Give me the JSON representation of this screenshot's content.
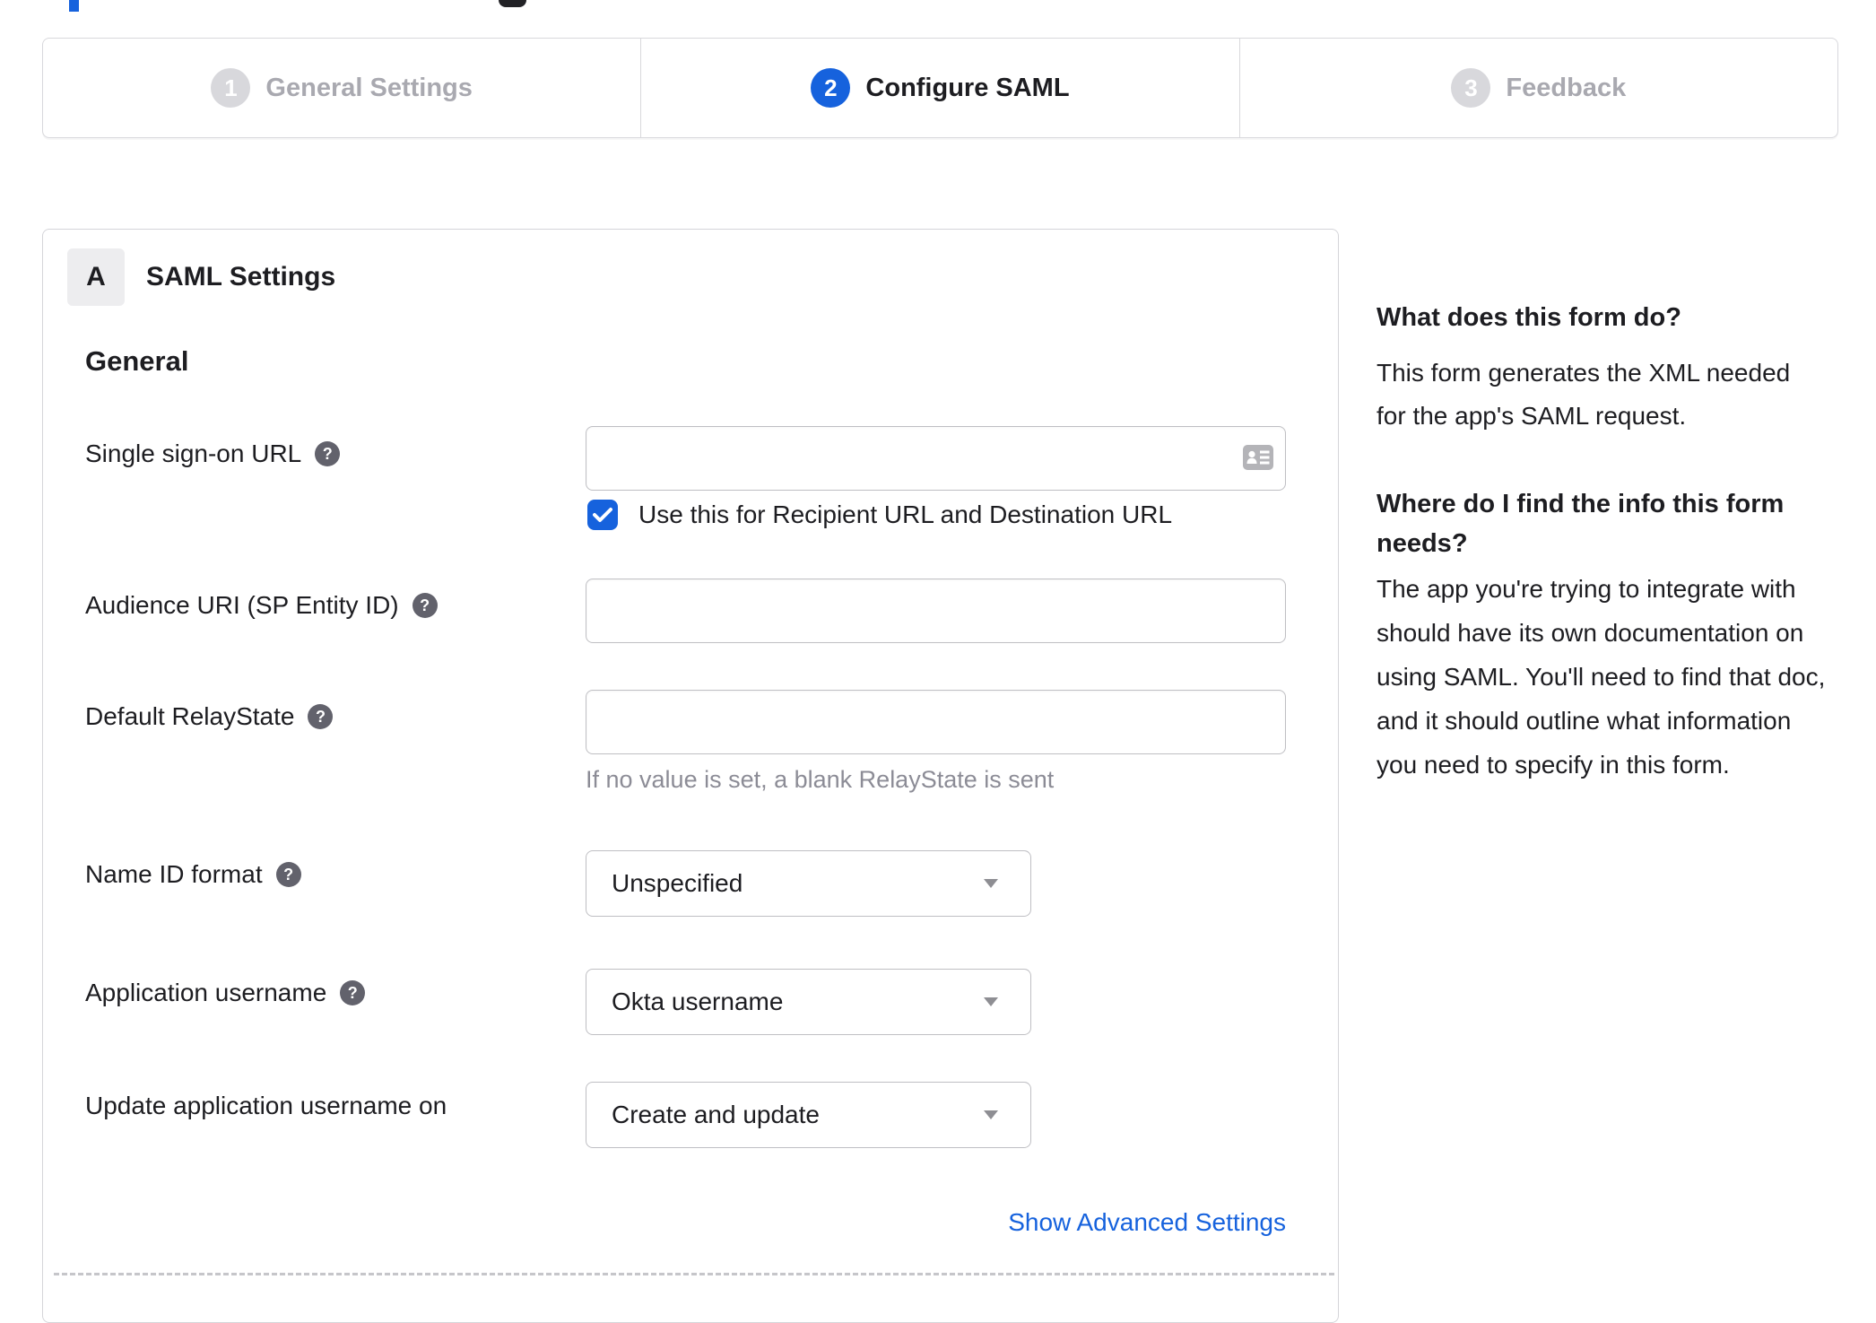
{
  "colors": {
    "accent": "#1662dd",
    "inactive_step": "#d8d8dc",
    "inactive_label": "#a9a9b0",
    "hint_text": "#8c8c96"
  },
  "icons": {
    "help": "?"
  },
  "stepper": {
    "steps": [
      {
        "num": "1",
        "label": "General Settings"
      },
      {
        "num": "2",
        "label": "Configure SAML"
      },
      {
        "num": "3",
        "label": "Feedback"
      }
    ],
    "active_step": "2"
  },
  "form": {
    "badge": "A",
    "title": "SAML Settings",
    "section": "General",
    "sso_label": "Single sign-on URL",
    "sso_value": "",
    "sso_checkbox_label": "Use this for Recipient URL and Destination URL",
    "sso_checkbox_checked": true,
    "audience_label": "Audience URI (SP Entity ID)",
    "audience_value": "",
    "relay_label": "Default RelayState",
    "relay_value": "",
    "relay_hint": "If no value is set, a blank RelayState is sent",
    "nameid_label": "Name ID format",
    "nameid_value": "Unspecified",
    "appuser_label": "Application username",
    "appuser_value": "Okta username",
    "updateuser_label": "Update application username on",
    "updateuser_value": "Create and update",
    "advanced_link": "Show Advanced Settings"
  },
  "sidebar": {
    "q1": "What does this form do?",
    "a1": "This form generates the XML needed for the app's SAML request.",
    "q2": "Where do I find the info this form needs?",
    "a2": "The app you're trying to integrate with should have its own documentation on using SAML. You'll need to find that doc, and it should outline what information you need to specify in this form."
  }
}
